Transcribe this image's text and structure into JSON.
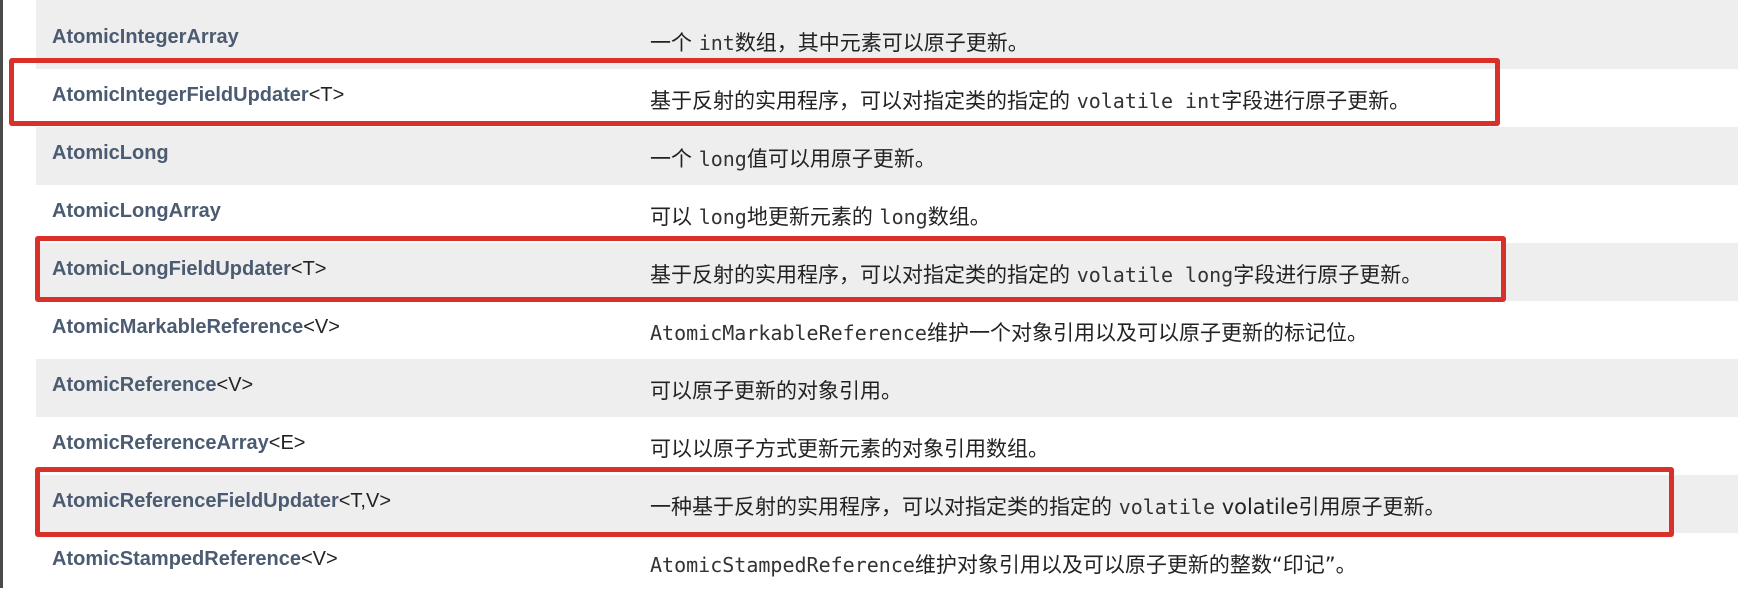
{
  "rows": [
    {
      "class_name": "AtomicIntegerArray",
      "generic": "",
      "description": [
        {
          "t": "一个 ",
          "code": false
        },
        {
          "t": "int",
          "code": true
        },
        {
          "t": "数组，其中元素可以原子更新。",
          "code": false
        }
      ]
    },
    {
      "class_name": "AtomicIntegerFieldUpdater",
      "generic": "<T>",
      "description": [
        {
          "t": "基于反射的实用程序，可以对指定类的指定的 ",
          "code": false
        },
        {
          "t": "volatile int",
          "code": true
        },
        {
          "t": "字段进行原子更新。",
          "code": false
        }
      ]
    },
    {
      "class_name": "AtomicLong",
      "generic": "",
      "description": [
        {
          "t": "一个 ",
          "code": false
        },
        {
          "t": "long",
          "code": true
        },
        {
          "t": "值可以用原子更新。",
          "code": false
        }
      ]
    },
    {
      "class_name": "AtomicLongArray",
      "generic": "",
      "description": [
        {
          "t": "可以 ",
          "code": false
        },
        {
          "t": "long",
          "code": true
        },
        {
          "t": "地更新元素的 ",
          "code": false
        },
        {
          "t": "long",
          "code": true
        },
        {
          "t": "数组。",
          "code": false
        }
      ]
    },
    {
      "class_name": "AtomicLongFieldUpdater",
      "generic": "<T>",
      "description": [
        {
          "t": "基于反射的实用程序，可以对指定类的指定的 ",
          "code": false
        },
        {
          "t": "volatile long",
          "code": true
        },
        {
          "t": "字段进行原子更新。",
          "code": false
        }
      ]
    },
    {
      "class_name": "AtomicMarkableReference",
      "generic": "<V>",
      "description": [
        {
          "t": "AtomicMarkableReference",
          "code": true
        },
        {
          "t": "维护一个对象引用以及可以原子更新的标记位。",
          "code": false
        }
      ]
    },
    {
      "class_name": "AtomicReference",
      "generic": "<V>",
      "description": [
        {
          "t": "可以原子更新的对象引用。",
          "code": false
        }
      ]
    },
    {
      "class_name": "AtomicReferenceArray",
      "generic": "<E>",
      "description": [
        {
          "t": "可以以原子方式更新元素的对象引用数组。",
          "code": false
        }
      ]
    },
    {
      "class_name": "AtomicReferenceFieldUpdater",
      "generic": "<T,V>",
      "description": [
        {
          "t": "一种基于反射的实用程序，可以对指定类的指定的 ",
          "code": false
        },
        {
          "t": "volatile",
          "code": true
        },
        {
          "t": " volatile引用原子更新。",
          "code": false
        }
      ]
    },
    {
      "class_name": "AtomicStampedReference",
      "generic": "<V>",
      "description": [
        {
          "t": "AtomicStampedReference",
          "code": true
        },
        {
          "t": "维护对象引用以及可以原子更新的整数“印记”。",
          "code": false
        }
      ]
    }
  ],
  "highlighted_rows": [
    1,
    4,
    8
  ],
  "colors": {
    "highlight_border": "#d9302a",
    "row_alt": "#eeeeef",
    "class_link": "#4b5b71",
    "text": "#222222"
  }
}
